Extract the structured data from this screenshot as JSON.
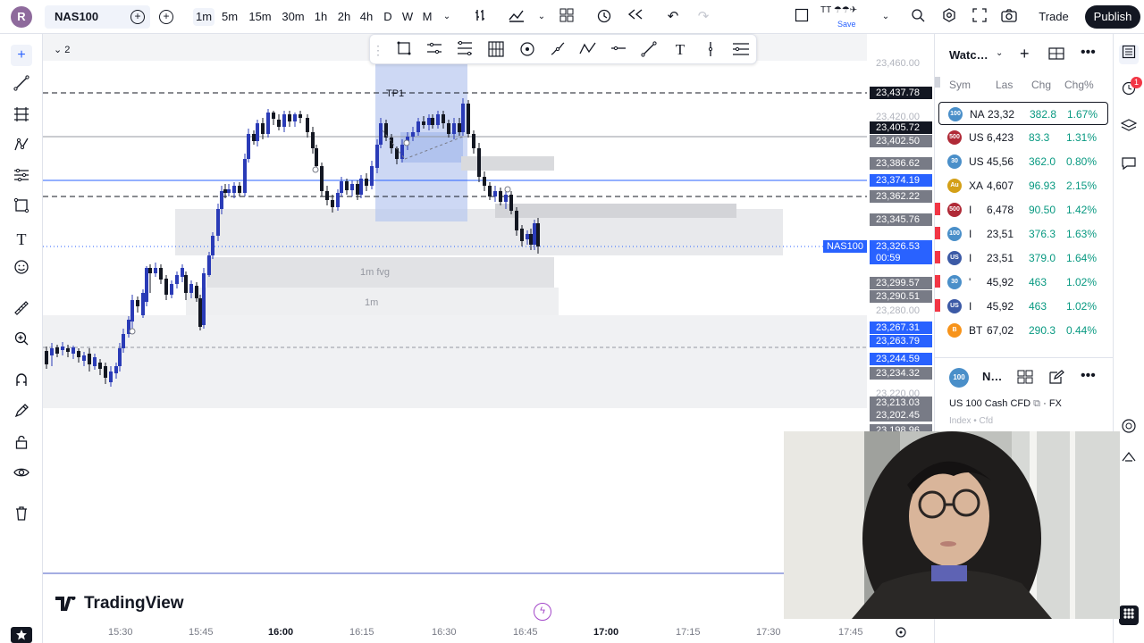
{
  "topbar": {
    "avatar_letter": "R",
    "symbol": "NAS100",
    "intervals": [
      "1m",
      "5m",
      "15m",
      "30m",
      "1h",
      "2h",
      "4h",
      "D",
      "W",
      "M"
    ],
    "active_interval": "1m",
    "layout_name": "TT",
    "save_label": "Save",
    "trade_label": "Trade",
    "publish_label": "Publish"
  },
  "chart": {
    "legend_count": "2",
    "labels": {
      "tp": "TP1",
      "fvg": "1m fvg",
      "zone": "1m"
    },
    "symbol_tag": "NAS100",
    "watermark": "TradingView",
    "colors": {
      "bull": "#2a3bb7",
      "bear": "#131722",
      "accent": "#2962ff",
      "zone": "#e8e9ec",
      "tp_zone": "#b8c8f0"
    }
  },
  "price_scale": {
    "labels": [
      {
        "text": "23,460.00",
        "style": "plain"
      },
      {
        "text": "23,437.78",
        "style": "dark"
      },
      {
        "text": "23,420.00",
        "style": "plain"
      },
      {
        "text": "23,405.72",
        "style": "dark"
      },
      {
        "text": "23,402.50",
        "style": "gray"
      },
      {
        "text": "23,386.62",
        "style": "gray"
      },
      {
        "text": "23,374.19",
        "style": "blue"
      },
      {
        "text": "23,362.22",
        "style": "gray"
      },
      {
        "text": "23,345.76",
        "style": "gray"
      },
      {
        "text": "23,326.53",
        "style": "blue"
      },
      {
        "text": "00:59",
        "style": "blue"
      },
      {
        "text": "23,299.57",
        "style": "gray"
      },
      {
        "text": "23,290.51",
        "style": "gray"
      },
      {
        "text": "23,280.00",
        "style": "plain"
      },
      {
        "text": "23,267.31",
        "style": "blue"
      },
      {
        "text": "23,263.79",
        "style": "blue"
      },
      {
        "text": "23,244.59",
        "style": "blue"
      },
      {
        "text": "23,234.32",
        "style": "gray"
      },
      {
        "text": "23,220.00",
        "style": "plain"
      },
      {
        "text": "23,213.03",
        "style": "gray"
      },
      {
        "text": "23,202.45",
        "style": "gray"
      },
      {
        "text": "23,198.96",
        "style": "gray"
      }
    ]
  },
  "time_axis": {
    "labels": [
      "15:30",
      "15:45",
      "16:00",
      "16:15",
      "16:30",
      "16:45",
      "17:00",
      "17:15",
      "17:30",
      "17:45"
    ]
  },
  "watchlist": {
    "title": "Watc…",
    "headers": {
      "symbol": "Sym",
      "last": "Las",
      "chg": "Chg",
      "chgp": "Chg%"
    },
    "rows": [
      {
        "icon": "100",
        "icon_color": "#4a8fc9",
        "symbol": "NA",
        "last": "23,32",
        "chg": "382.8",
        "chgp": "1.67%",
        "flag": false,
        "selected": true
      },
      {
        "icon": "500",
        "icon_color": "#b02a37",
        "symbol": "US",
        "last": "6,423",
        "chg": "83.3",
        "chgp": "1.31%",
        "flag": false,
        "selected": false
      },
      {
        "icon": "30",
        "icon_color": "#4a8fc9",
        "symbol": "US",
        "last": "45,56",
        "chg": "362.0",
        "chgp": "0.80%",
        "flag": false,
        "selected": false
      },
      {
        "icon": "Au",
        "icon_color": "#d4a017",
        "symbol": "XA",
        "last": "4,607",
        "chg": "96.93",
        "chgp": "2.15%",
        "flag": false,
        "selected": false
      },
      {
        "icon": "500",
        "icon_color": "#b02a37",
        "symbol": "I",
        "last": "6,478",
        "chg": "90.50",
        "chgp": "1.42%",
        "flag": true,
        "selected": false
      },
      {
        "icon": "100",
        "icon_color": "#4a8fc9",
        "symbol": "I",
        "last": "23,51",
        "chg": "376.3",
        "chgp": "1.63%",
        "flag": true,
        "selected": false
      },
      {
        "icon": "US",
        "icon_color": "#3c5aa6",
        "symbol": "I",
        "last": "23,51",
        "chg": "379.0",
        "chgp": "1.64%",
        "flag": true,
        "selected": false
      },
      {
        "icon": "30",
        "icon_color": "#4a8fc9",
        "symbol": "'",
        "last": "45,92",
        "chg": "463",
        "chgp": "1.02%",
        "flag": true,
        "selected": false
      },
      {
        "icon": "US",
        "icon_color": "#3c5aa6",
        "symbol": "I",
        "last": "45,92",
        "chg": "463",
        "chgp": "1.02%",
        "flag": true,
        "selected": false
      },
      {
        "icon": "B",
        "icon_color": "#f7931a",
        "symbol": "BT",
        "last": "67,02",
        "chg": "290.3",
        "chgp": "0.44%",
        "flag": false,
        "selected": false
      }
    ]
  },
  "details": {
    "icon": "100",
    "name": "N…",
    "description": "US 100 Cash CFD",
    "market": "FX",
    "category": "Index • Cfd"
  },
  "alert_badge": "1"
}
